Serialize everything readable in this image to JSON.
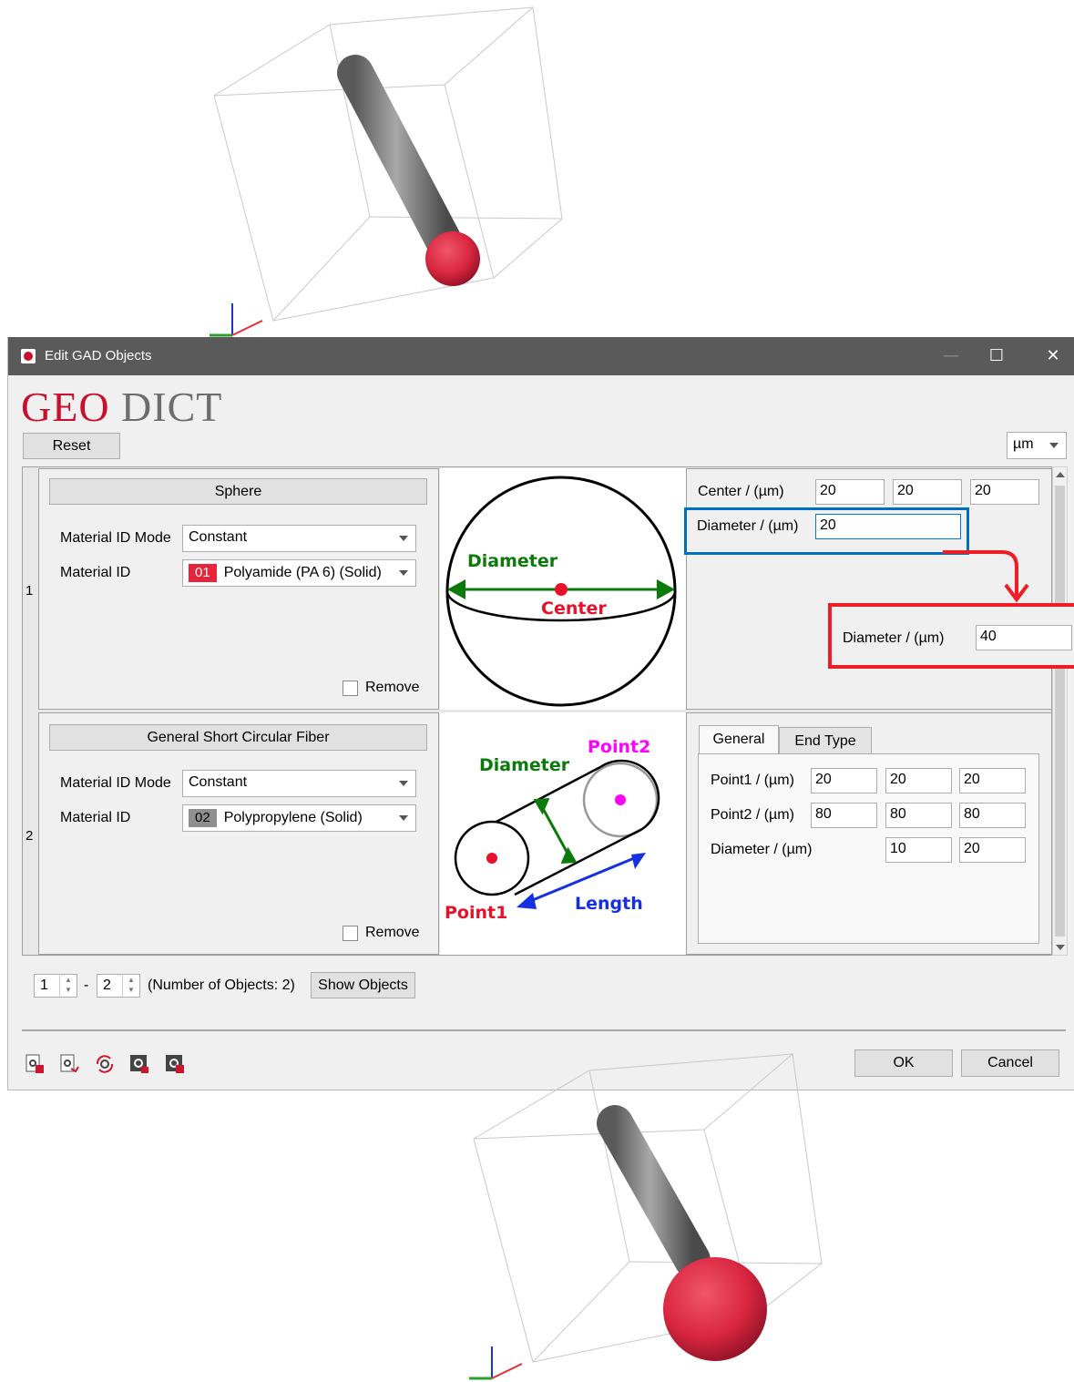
{
  "window": {
    "title": "Edit GAD Objects",
    "controls": [
      "—",
      "☐",
      "✕"
    ]
  },
  "logo": {
    "geo": "GEO",
    "dict": "DICT"
  },
  "toolbar": {
    "reset_label": "Reset",
    "unit": "µm"
  },
  "objects": [
    {
      "row_number": "1",
      "type_label": "Sphere",
      "material_id_mode_label": "Material ID Mode",
      "material_id_mode_value": "Constant",
      "material_id_label": "Material ID",
      "material_chip": "01",
      "material_name": "Polyamide (PA 6) (Solid)",
      "material_color": "#e8243c",
      "remove_label": "Remove",
      "diagram": {
        "diameter": "Diameter",
        "center": "Center"
      },
      "center_label": "Center / (µm)",
      "center_values": [
        "20",
        "20",
        "20"
      ],
      "diameter_label": "Diameter / (µm)",
      "diameter_value": "20"
    },
    {
      "row_number": "2",
      "type_label": "General Short Circular Fiber",
      "material_id_mode_label": "Material ID Mode",
      "material_id_mode_value": "Constant",
      "material_id_label": "Material ID",
      "material_chip": "02",
      "material_name": "Polypropylene (Solid)",
      "material_color": "#8f8f8f",
      "remove_label": "Remove",
      "diagram": {
        "diameter": "Diameter",
        "point1": "Point1",
        "point2": "Point2",
        "length": "Length"
      },
      "tabs": [
        "General",
        "End Type"
      ],
      "point1_label": "Point1 / (µm)",
      "point1_values": [
        "20",
        "20",
        "20"
      ],
      "point2_label": "Point2 / (µm)",
      "point2_values": [
        "80",
        "80",
        "80"
      ],
      "diameter_label": "Diameter / (µm)",
      "diameter_values": [
        "10",
        "20"
      ]
    }
  ],
  "callout": {
    "label": "Diameter / (µm)",
    "value": "40"
  },
  "footer": {
    "range_from": "1",
    "range_sep": "-",
    "range_to": "2",
    "count_text": "(Number of Objects: 2)",
    "show_objects_label": "Show Objects",
    "ok_label": "OK",
    "cancel_label": "Cancel"
  },
  "colors": {
    "accent": "#c8102e",
    "callout_blue": "#0070c0",
    "callout_red": "#ee1c25",
    "sphere_red": "#d9263f",
    "fiber_grey": "#8a8a8a"
  }
}
